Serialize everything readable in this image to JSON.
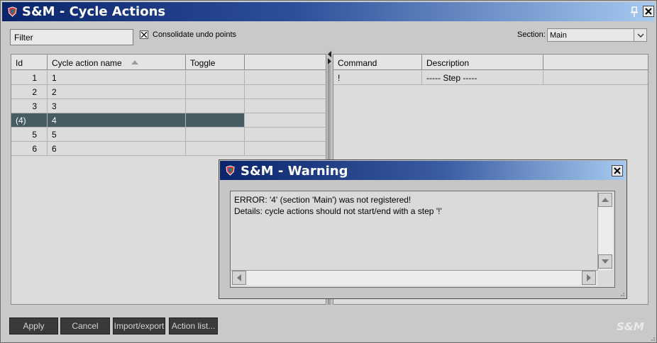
{
  "window": {
    "title": "S&M - Cycle Actions"
  },
  "toolbar": {
    "filter_value": "Filter",
    "consolidate_label": "Consolidate undo points",
    "consolidate_checked": true,
    "section_label": "Section:",
    "section_value": "Main"
  },
  "actions_table": {
    "columns": [
      "Id",
      "Cycle action name",
      "Toggle"
    ],
    "sort_column": "Cycle action name",
    "rows": [
      {
        "id": "1",
        "name": "1",
        "toggle": ""
      },
      {
        "id": "2",
        "name": "2",
        "toggle": ""
      },
      {
        "id": "3",
        "name": "3",
        "toggle": ""
      },
      {
        "id": "(4)",
        "name": "4",
        "toggle": "",
        "selected": true
      },
      {
        "id": "5",
        "name": "5",
        "toggle": ""
      },
      {
        "id": "6",
        "name": "6",
        "toggle": ""
      }
    ]
  },
  "commands_table": {
    "columns": [
      "Command",
      "Description"
    ],
    "rows": [
      {
        "command": "!",
        "description": "----- Step -----"
      }
    ]
  },
  "buttons": {
    "apply": "Apply",
    "cancel": "Cancel",
    "import_export": "Import/export",
    "action_list": "Action list..."
  },
  "logo_text": "S&M",
  "warning": {
    "title": "S&M - Warning",
    "line1": "ERROR: '4' (section 'Main') was not registered!",
    "line2": "Details: cycle actions should not start/end with a step '!'"
  },
  "colors": {
    "titlebar_start": "#0a246a",
    "titlebar_end": "#a6caf0",
    "selected_row": "#475c63",
    "button_bg": "#3a3a3a"
  }
}
